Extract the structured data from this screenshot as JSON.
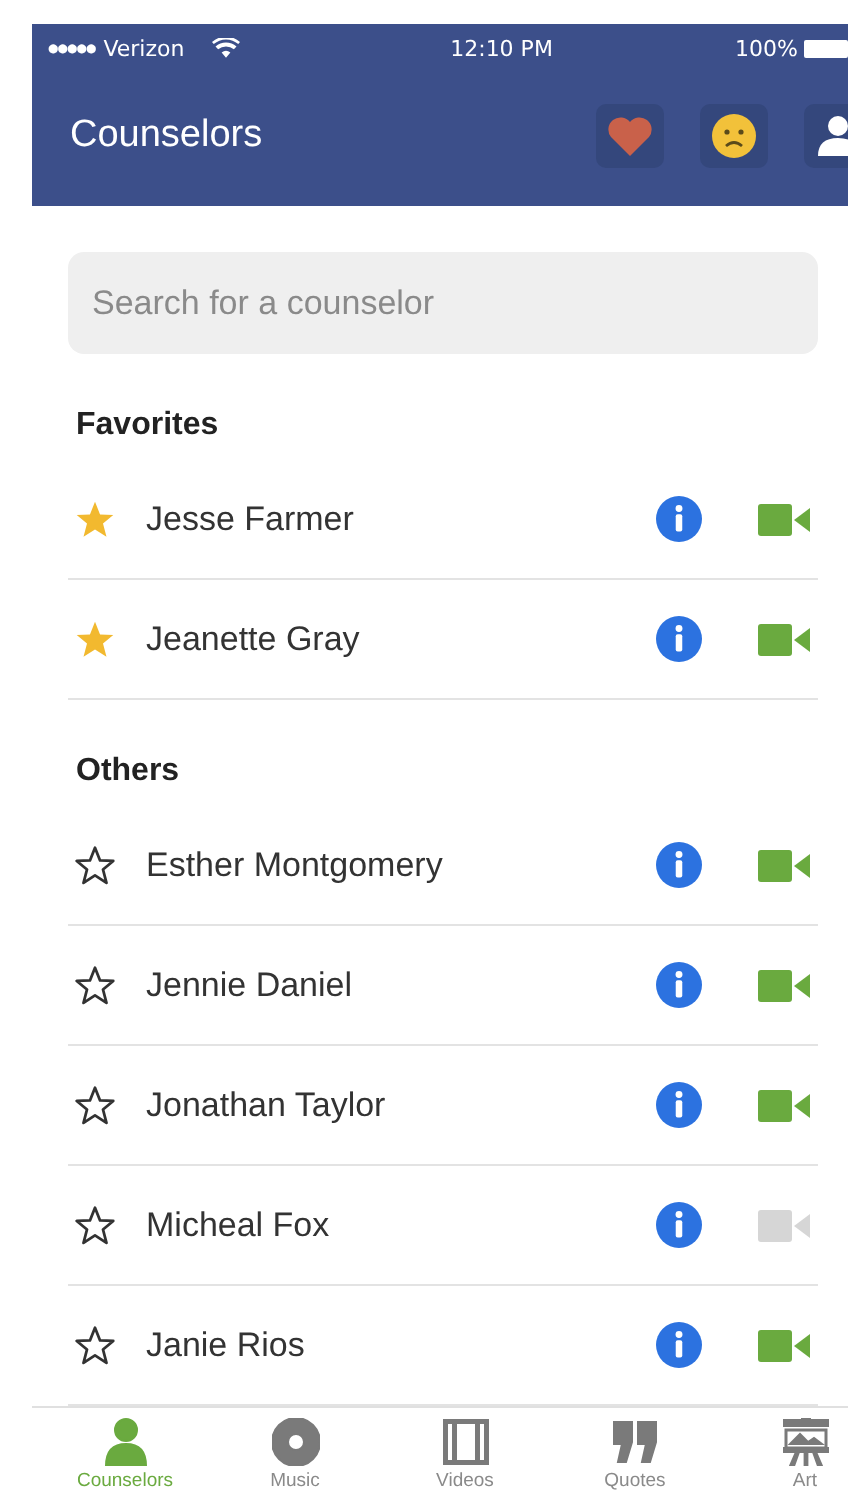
{
  "status_bar": {
    "signal": "●●●●●",
    "carrier": "Verizon",
    "time": "12:10 PM",
    "battery": "100%"
  },
  "nav_bar": {
    "title": "Counselors"
  },
  "search": {
    "placeholder": "Search for a counselor"
  },
  "sections": [
    {
      "title": "Favorites",
      "counselors": [
        {
          "name": "Jesse Farmer",
          "favorite": true,
          "video_available": true
        },
        {
          "name": "Jeanette Gray",
          "favorite": true,
          "video_available": true
        }
      ]
    },
    {
      "title": "Others",
      "counselors": [
        {
          "name": "Esther Montgomery",
          "favorite": false,
          "video_available": true
        },
        {
          "name": "Jennie Daniel",
          "favorite": false,
          "video_available": true
        },
        {
          "name": "Jonathan Taylor",
          "favorite": false,
          "video_available": true
        },
        {
          "name": "Micheal Fox",
          "favorite": false,
          "video_available": false
        },
        {
          "name": "Janie Rios",
          "favorite": false,
          "video_available": true
        }
      ]
    }
  ],
  "tab_bar": [
    {
      "label": "Counselors",
      "kind": "person",
      "selected": true
    },
    {
      "label": "Music",
      "kind": "disc",
      "selected": false
    },
    {
      "label": "Videos",
      "kind": "film",
      "selected": false
    },
    {
      "label": "Quotes",
      "kind": "quote",
      "selected": false
    },
    {
      "label": "Art",
      "kind": "easel",
      "selected": false
    }
  ]
}
